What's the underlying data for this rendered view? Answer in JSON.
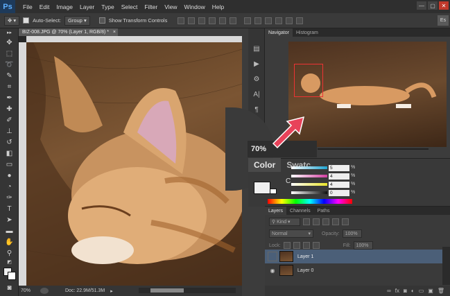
{
  "app": {
    "logo": "Ps"
  },
  "menu": [
    "File",
    "Edit",
    "Image",
    "Layer",
    "Type",
    "Select",
    "Filter",
    "View",
    "Window",
    "Help"
  ],
  "window_controls": [
    "—",
    "▢",
    "✕"
  ],
  "options": {
    "auto_select_label": "Auto-Select:",
    "auto_select_value": "Group",
    "show_transform_label": "Show Transform Controls",
    "essentials": "Es"
  },
  "document": {
    "tab_title": "BIZ-008.JPG @ 70% (Layer 1, RGB/8) *",
    "close": "×",
    "zoom": "70%",
    "doc_size": "Doc: 22.9M/51.3M"
  },
  "navigator": {
    "tabs": [
      "Navigator",
      "Histogram"
    ],
    "zoom": "70%"
  },
  "color": {
    "tabs": [
      "Color",
      "Swatc"
    ],
    "mode_label": "C",
    "values": [
      "5",
      "4",
      "4",
      "0"
    ],
    "percent": "%",
    "cmyk_colors": [
      "#1fa3d1",
      "#d13ea0",
      "#e8e32a",
      "#111111"
    ]
  },
  "layers": {
    "tabs": [
      "Layers",
      "Channels",
      "Paths"
    ],
    "kind": "Kind",
    "blend_mode": "Normal",
    "opacity_label": "Opacity:",
    "opacity_value": "100%",
    "lock_label": "Lock:",
    "fill_label": "Fill:",
    "fill_value": "100%",
    "items": [
      {
        "name": "Layer 1",
        "selected": true
      },
      {
        "name": "Layer 0",
        "selected": false
      }
    ]
  },
  "colors": {
    "highlight": "#e33b3b",
    "selected_layer": "#4b5f78"
  }
}
